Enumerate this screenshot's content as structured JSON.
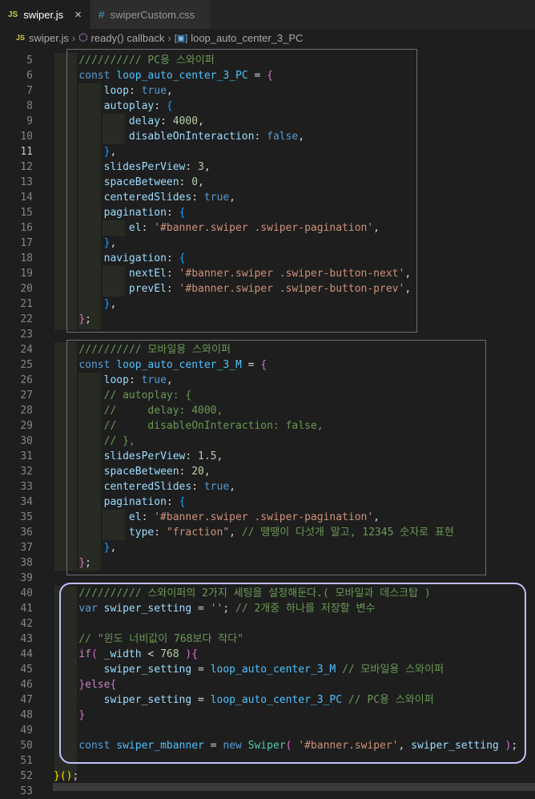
{
  "tabs": [
    {
      "icon": "JS",
      "label": "swiper.js",
      "close": "×",
      "active": true
    },
    {
      "icon": "#",
      "label": "swiperCustom.css",
      "active": false
    }
  ],
  "breadcrumb": {
    "file_icon": "JS",
    "file": "swiper.js",
    "fn": "ready() callback",
    "symbol": "loop_auto_center_3_PC"
  },
  "gutter": [
    "5",
    "6",
    "7",
    "8",
    "9",
    "10",
    "11",
    "12",
    "13",
    "14",
    "15",
    "16",
    "17",
    "18",
    "19",
    "20",
    "21",
    "22",
    "23",
    "24",
    "25",
    "26",
    "27",
    "28",
    "29",
    "30",
    "31",
    "32",
    "33",
    "34",
    "35",
    "36",
    "37",
    "38",
    "39",
    "40",
    "41",
    "42",
    "43",
    "44",
    "45",
    "46",
    "47",
    "48",
    "49",
    "50",
    "51",
    "52",
    "53"
  ],
  "current_line": "11",
  "code": [
    [
      [
        "c",
        "    "
      ],
      [
        "com",
        "////////// PC용 스와이퍼"
      ]
    ],
    [
      [
        "c",
        "    "
      ],
      [
        "kw",
        "const "
      ],
      [
        "var",
        "loop_auto_center_3_PC"
      ],
      [
        "plain",
        " = "
      ],
      [
        "brk2",
        "{"
      ]
    ],
    [
      [
        "c",
        "        "
      ],
      [
        "prop",
        "loop"
      ],
      [
        "plain",
        ": "
      ],
      [
        "kw",
        "true"
      ],
      [
        "plain",
        ","
      ]
    ],
    [
      [
        "c",
        "        "
      ],
      [
        "prop",
        "autoplay"
      ],
      [
        "plain",
        ": "
      ],
      [
        "brk3",
        "{"
      ]
    ],
    [
      [
        "c",
        "            "
      ],
      [
        "prop",
        "delay"
      ],
      [
        "plain",
        ": "
      ],
      [
        "num",
        "4000"
      ],
      [
        "plain",
        ","
      ]
    ],
    [
      [
        "c",
        "            "
      ],
      [
        "prop",
        "disableOnInteraction"
      ],
      [
        "plain",
        ": "
      ],
      [
        "kw",
        "false"
      ],
      [
        "plain",
        ","
      ]
    ],
    [
      [
        "c",
        "        "
      ],
      [
        "brk3",
        "}"
      ],
      [
        "plain",
        ","
      ]
    ],
    [
      [
        "c",
        "        "
      ],
      [
        "prop",
        "slidesPerView"
      ],
      [
        "plain",
        ": "
      ],
      [
        "num",
        "3"
      ],
      [
        "plain",
        ","
      ]
    ],
    [
      [
        "c",
        "        "
      ],
      [
        "prop",
        "spaceBetween"
      ],
      [
        "plain",
        ": "
      ],
      [
        "num",
        "0"
      ],
      [
        "plain",
        ","
      ]
    ],
    [
      [
        "c",
        "        "
      ],
      [
        "prop",
        "centeredSlides"
      ],
      [
        "plain",
        ": "
      ],
      [
        "kw",
        "true"
      ],
      [
        "plain",
        ","
      ]
    ],
    [
      [
        "c",
        "        "
      ],
      [
        "prop",
        "pagination"
      ],
      [
        "plain",
        ": "
      ],
      [
        "brk3",
        "{"
      ]
    ],
    [
      [
        "c",
        "            "
      ],
      [
        "prop",
        "el"
      ],
      [
        "plain",
        ": "
      ],
      [
        "str",
        "'#banner.swiper .swiper-pagination'"
      ],
      [
        "plain",
        ","
      ]
    ],
    [
      [
        "c",
        "        "
      ],
      [
        "brk3",
        "}"
      ],
      [
        "plain",
        ","
      ]
    ],
    [
      [
        "c",
        "        "
      ],
      [
        "prop",
        "navigation"
      ],
      [
        "plain",
        ": "
      ],
      [
        "brk3",
        "{"
      ]
    ],
    [
      [
        "c",
        "            "
      ],
      [
        "prop",
        "nextEl"
      ],
      [
        "plain",
        ": "
      ],
      [
        "str",
        "'#banner.swiper .swiper-button-next'"
      ],
      [
        "plain",
        ","
      ]
    ],
    [
      [
        "c",
        "            "
      ],
      [
        "prop",
        "prevEl"
      ],
      [
        "plain",
        ": "
      ],
      [
        "str",
        "'#banner.swiper .swiper-button-prev'"
      ],
      [
        "plain",
        ","
      ]
    ],
    [
      [
        "c",
        "        "
      ],
      [
        "brk3",
        "}"
      ],
      [
        "plain",
        ","
      ]
    ],
    [
      [
        "c",
        "    "
      ],
      [
        "brk2",
        "}"
      ],
      [
        "plain",
        ";"
      ]
    ],
    [
      [
        "c",
        ""
      ]
    ],
    [
      [
        "c",
        "    "
      ],
      [
        "com",
        "////////// 모바일용 스와이퍼"
      ]
    ],
    [
      [
        "c",
        "    "
      ],
      [
        "kw",
        "const "
      ],
      [
        "var",
        "loop_auto_center_3_M"
      ],
      [
        "plain",
        " = "
      ],
      [
        "brk2",
        "{"
      ]
    ],
    [
      [
        "c",
        "        "
      ],
      [
        "prop",
        "loop"
      ],
      [
        "plain",
        ": "
      ],
      [
        "kw",
        "true"
      ],
      [
        "plain",
        ","
      ]
    ],
    [
      [
        "c",
        "        "
      ],
      [
        "com",
        "// autoplay: {"
      ]
    ],
    [
      [
        "c",
        "        "
      ],
      [
        "com",
        "//     delay: 4000,"
      ]
    ],
    [
      [
        "c",
        "        "
      ],
      [
        "com",
        "//     disableOnInteraction: false,"
      ]
    ],
    [
      [
        "c",
        "        "
      ],
      [
        "com",
        "// },"
      ]
    ],
    [
      [
        "c",
        "        "
      ],
      [
        "prop",
        "slidesPerView"
      ],
      [
        "plain",
        ": "
      ],
      [
        "num",
        "1.5"
      ],
      [
        "plain",
        ","
      ]
    ],
    [
      [
        "c",
        "        "
      ],
      [
        "prop",
        "spaceBetween"
      ],
      [
        "plain",
        ": "
      ],
      [
        "num",
        "20"
      ],
      [
        "plain",
        ","
      ]
    ],
    [
      [
        "c",
        "        "
      ],
      [
        "prop",
        "centeredSlides"
      ],
      [
        "plain",
        ": "
      ],
      [
        "kw",
        "true"
      ],
      [
        "plain",
        ","
      ]
    ],
    [
      [
        "c",
        "        "
      ],
      [
        "prop",
        "pagination"
      ],
      [
        "plain",
        ": "
      ],
      [
        "brk3",
        "{"
      ]
    ],
    [
      [
        "c",
        "            "
      ],
      [
        "prop",
        "el"
      ],
      [
        "plain",
        ": "
      ],
      [
        "str",
        "'#banner.swiper .swiper-pagination'"
      ],
      [
        "plain",
        ","
      ]
    ],
    [
      [
        "c",
        "            "
      ],
      [
        "prop",
        "type"
      ],
      [
        "plain",
        ": "
      ],
      [
        "str",
        "\"fraction\""
      ],
      [
        "plain",
        ", "
      ],
      [
        "com",
        "// 땡땡이 다섯개 말고, 12345 숫자로 표현"
      ]
    ],
    [
      [
        "c",
        "        "
      ],
      [
        "brk3",
        "}"
      ],
      [
        "plain",
        ","
      ]
    ],
    [
      [
        "c",
        "    "
      ],
      [
        "brk2",
        "}"
      ],
      [
        "plain",
        ";"
      ]
    ],
    [
      [
        "c",
        ""
      ]
    ],
    [
      [
        "c",
        "    "
      ],
      [
        "com",
        "////////// 스와이퍼의 2가지 세팅을 설정해둔다.( 모바일과 데스크탑 )"
      ]
    ],
    [
      [
        "c",
        "    "
      ],
      [
        "kw",
        "var "
      ],
      [
        "prop",
        "swiper_setting"
      ],
      [
        "plain",
        " = "
      ],
      [
        "str",
        "''"
      ],
      [
        "plain",
        "; "
      ],
      [
        "com",
        "// 2개중 하나를 저장할 변수"
      ]
    ],
    [
      [
        "c",
        ""
      ]
    ],
    [
      [
        "c",
        "    "
      ],
      [
        "com",
        "// \"윈도 너비값이 768보다 작다\""
      ]
    ],
    [
      [
        "c",
        "    "
      ],
      [
        "ctl",
        "if"
      ],
      [
        "brk2",
        "("
      ],
      [
        "plain",
        " "
      ],
      [
        "prop",
        "_width"
      ],
      [
        "plain",
        " < "
      ],
      [
        "num",
        "768"
      ],
      [
        "plain",
        " "
      ],
      [
        "brk2",
        ")"
      ],
      [
        "brk2",
        "{"
      ]
    ],
    [
      [
        "c",
        "        "
      ],
      [
        "prop",
        "swiper_setting"
      ],
      [
        "plain",
        " = "
      ],
      [
        "var",
        "loop_auto_center_3_M"
      ],
      [
        "plain",
        " "
      ],
      [
        "com",
        "// 모바일용 스와이퍼"
      ]
    ],
    [
      [
        "c",
        "    "
      ],
      [
        "brk2",
        "}"
      ],
      [
        "ctl",
        "else"
      ],
      [
        "brk2",
        "{"
      ]
    ],
    [
      [
        "c",
        "        "
      ],
      [
        "prop",
        "swiper_setting"
      ],
      [
        "plain",
        " = "
      ],
      [
        "var",
        "loop_auto_center_3_PC"
      ],
      [
        "plain",
        " "
      ],
      [
        "com",
        "// PC용 스와이퍼"
      ]
    ],
    [
      [
        "c",
        "    "
      ],
      [
        "brk2",
        "}"
      ]
    ],
    [
      [
        "c",
        ""
      ]
    ],
    [
      [
        "c",
        "    "
      ],
      [
        "kw",
        "const "
      ],
      [
        "var",
        "swiper_mbanner"
      ],
      [
        "plain",
        " = "
      ],
      [
        "kw",
        "new "
      ],
      [
        "cls",
        "Swiper"
      ],
      [
        "brk2",
        "("
      ],
      [
        "plain",
        " "
      ],
      [
        "str",
        "'#banner.swiper'"
      ],
      [
        "plain",
        ", "
      ],
      [
        "prop",
        "swiper_setting"
      ],
      [
        "plain",
        " "
      ],
      [
        "brk2",
        ")"
      ],
      [
        "plain",
        ";"
      ]
    ],
    [
      [
        "c",
        ""
      ]
    ],
    [
      [
        "brk",
        "}"
      ],
      [
        "brk",
        "("
      ],
      [
        "brk",
        ")"
      ],
      [
        "plain",
        ";"
      ]
    ],
    [
      [
        "c",
        ""
      ]
    ]
  ]
}
